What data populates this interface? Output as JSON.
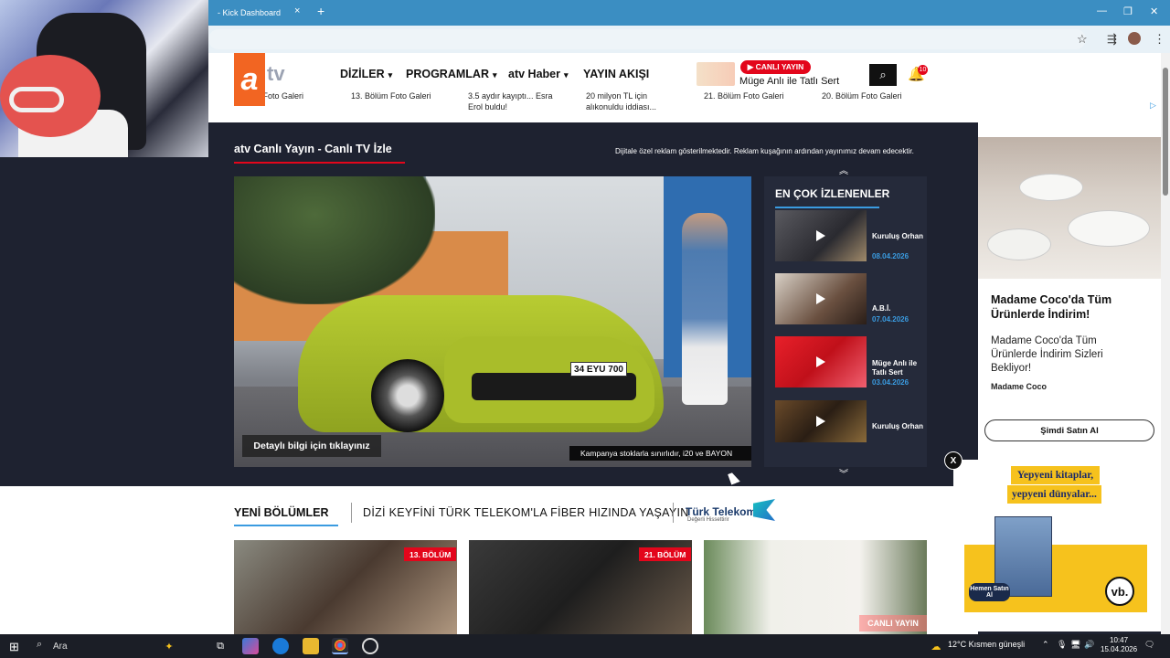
{
  "browser": {
    "tab_title": "- Kick Dashboard",
    "tab_close": "×",
    "new_tab": "+",
    "minimize": "—",
    "maximize": "❐",
    "close": "✕"
  },
  "header": {
    "logo_a": "a",
    "logo_tv": "tv",
    "nav": [
      "DİZİLER",
      "PROGRAMLAR",
      "atv Haber",
      "YAYIN AKIŞI"
    ],
    "live_label": "▶ CANLI YAYIN",
    "live_show": "Müge Anlı ile Tatlı Sert",
    "notification_count": "10"
  },
  "strip": [
    "...ölüm Foto Galeri",
    "13. Bölüm Foto Galeri",
    "3.5 aydır kayıptı... Esra Erol buldu!",
    "20 milyon TL için alıkonuldu iddiası...",
    "21. Bölüm Foto Galeri",
    "20. Bölüm Foto Galeri"
  ],
  "live": {
    "title": "atv Canlı Yayın - Canlı TV İzle",
    "ad_note": "Dijitale özel reklam gösterilmektedir. Reklam kuşağının ardından yayınımız devam edecektir.",
    "detail_button": "Detaylı bilgi için tıklayınız",
    "caption": "Kampanya stoklarla sınırlıdır, i20 ve BAYON",
    "plate": "34 EYU 700"
  },
  "most_watched": {
    "title": "EN ÇOK İZLENENLER",
    "items": [
      {
        "name": "Kuruluş Orhan",
        "date": "08.04.2026"
      },
      {
        "name": "A.B.İ.",
        "date": "07.04.2026"
      },
      {
        "name": "Müge Anlı ile Tatlı Sert",
        "date": "03.04.2026"
      },
      {
        "name": "Kuruluş Orhan",
        "date": ""
      }
    ]
  },
  "side_ad": {
    "headline": "Madame Coco'da Tüm Ürünlerde İndirim!",
    "body": "Madame Coco'da Tüm Ürünlerde İndirim Sizleri Bekliyor!",
    "brand": "Madame Coco",
    "cta": "Şimdi Satın Al",
    "choice": "▷"
  },
  "lower": {
    "section_title": "YENİ BÖLÜMLER",
    "promo": "DİZİ KEYFİNİ TÜRK TELEKOM'LA FİBER HIZINDA YAŞAYIN",
    "tt_logo": "Türk Telekom",
    "tt_sub": "Değerli Hissettirir",
    "episodes": [
      {
        "badge": "13. BÖLÜM"
      },
      {
        "badge": "21. BÖLÜM"
      },
      {
        "badge": "CANLI YAYIN"
      }
    ]
  },
  "book_ad": {
    "close": "X",
    "line1": "Yepyeni kitaplar,",
    "line2": "yepyeni dünyalar...",
    "buy": "Hemen Satın Al",
    "logo": "vb."
  },
  "taskbar": {
    "search": "Ara",
    "weather": "12°C  Kısmen güneşli",
    "time": "10:47",
    "date": "15.04.2026"
  }
}
